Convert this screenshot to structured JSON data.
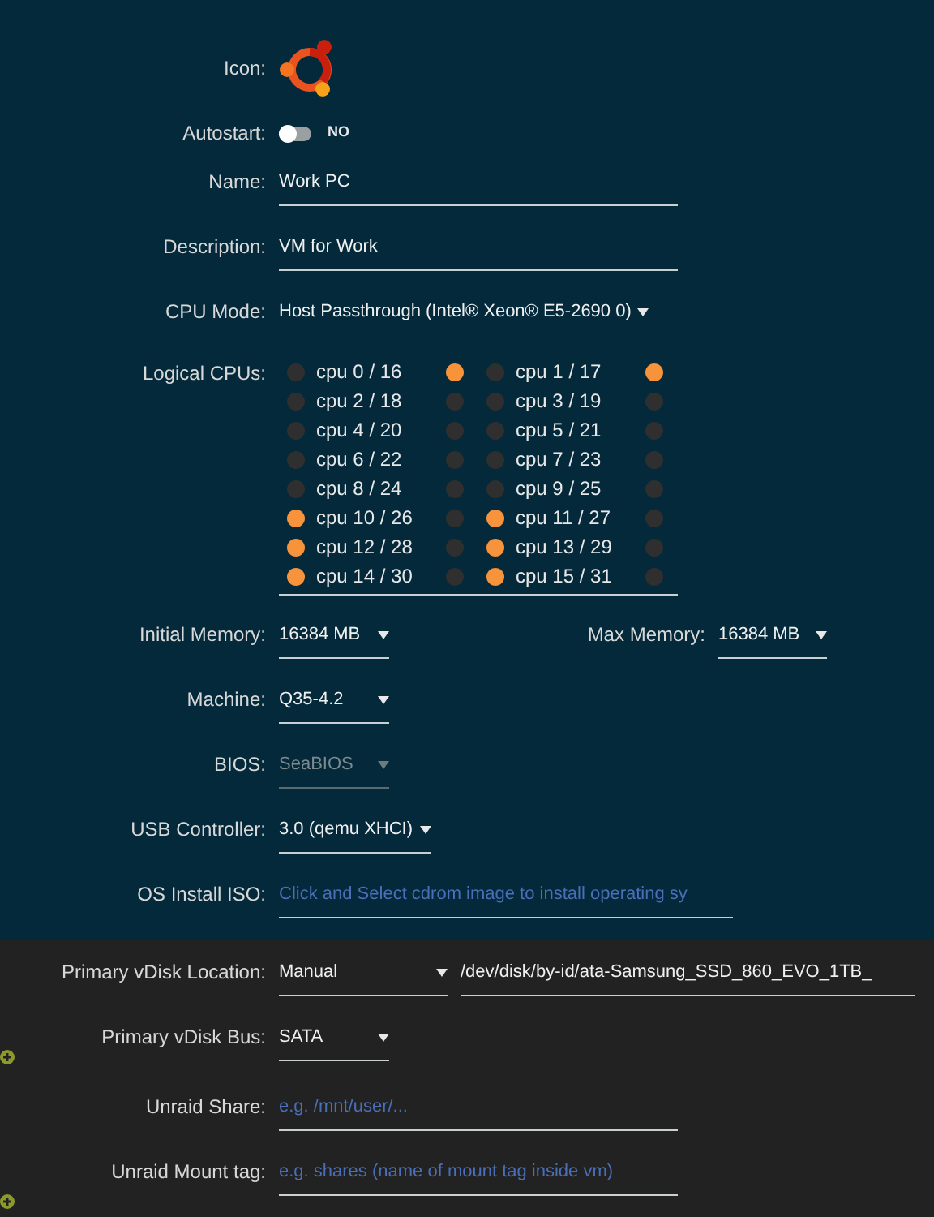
{
  "icon": {
    "label": "Icon:"
  },
  "autostart": {
    "label": "Autostart:",
    "on": false,
    "state_text": "NO"
  },
  "name": {
    "label": "Name:",
    "value": "Work PC"
  },
  "description": {
    "label": "Description:",
    "value": "VM for Work"
  },
  "cpu_mode": {
    "label": "CPU Mode:",
    "value": "Host Passthrough (Intel® Xeon® E5-2690 0)"
  },
  "logical_cpus": {
    "label": "Logical CPUs:",
    "cpus": [
      {
        "label": "cpu 0 / 16",
        "checked": false,
        "sibling_checked": true
      },
      {
        "label": "cpu 1 / 17",
        "checked": false,
        "sibling_checked": true
      },
      {
        "label": "cpu 2 / 18",
        "checked": false,
        "sibling_checked": false
      },
      {
        "label": "cpu 3 / 19",
        "checked": false,
        "sibling_checked": false
      },
      {
        "label": "cpu 4 / 20",
        "checked": false,
        "sibling_checked": false
      },
      {
        "label": "cpu 5 / 21",
        "checked": false,
        "sibling_checked": false
      },
      {
        "label": "cpu 6 / 22",
        "checked": false,
        "sibling_checked": false
      },
      {
        "label": "cpu 7 / 23",
        "checked": false,
        "sibling_checked": false
      },
      {
        "label": "cpu 8 / 24",
        "checked": false,
        "sibling_checked": false
      },
      {
        "label": "cpu 9 / 25",
        "checked": false,
        "sibling_checked": false
      },
      {
        "label": "cpu 10 / 26",
        "checked": true,
        "sibling_checked": false
      },
      {
        "label": "cpu 11 / 27",
        "checked": true,
        "sibling_checked": false
      },
      {
        "label": "cpu 12 / 28",
        "checked": true,
        "sibling_checked": false
      },
      {
        "label": "cpu 13 / 29",
        "checked": true,
        "sibling_checked": false
      },
      {
        "label": "cpu 14 / 30",
        "checked": true,
        "sibling_checked": false
      },
      {
        "label": "cpu 15 / 31",
        "checked": true,
        "sibling_checked": false
      }
    ]
  },
  "initial_memory": {
    "label": "Initial Memory:",
    "value": "16384 MB"
  },
  "max_memory": {
    "label": "Max Memory:",
    "value": "16384 MB"
  },
  "machine": {
    "label": "Machine:",
    "value": "Q35-4.2"
  },
  "bios": {
    "label": "BIOS:",
    "value": "SeaBIOS",
    "disabled": true
  },
  "usb_controller": {
    "label": "USB Controller:",
    "value": "3.0 (qemu XHCI)"
  },
  "os_install_iso": {
    "label": "OS Install ISO:",
    "placeholder": "Click and Select cdrom image to install operating sy"
  },
  "vdisk_location": {
    "label": "Primary vDisk Location:",
    "value": "Manual",
    "path": "/dev/disk/by-id/ata-Samsung_SSD_860_EVO_1TB_"
  },
  "vdisk_bus": {
    "label": "Primary vDisk Bus:",
    "value": "SATA"
  },
  "unraid_share": {
    "label": "Unraid Share:",
    "placeholder": "e.g. /mnt/user/..."
  },
  "unraid_mount_tag": {
    "label": "Unraid Mount tag:",
    "placeholder": "e.g. shares (name of mount tag inside vm)"
  }
}
